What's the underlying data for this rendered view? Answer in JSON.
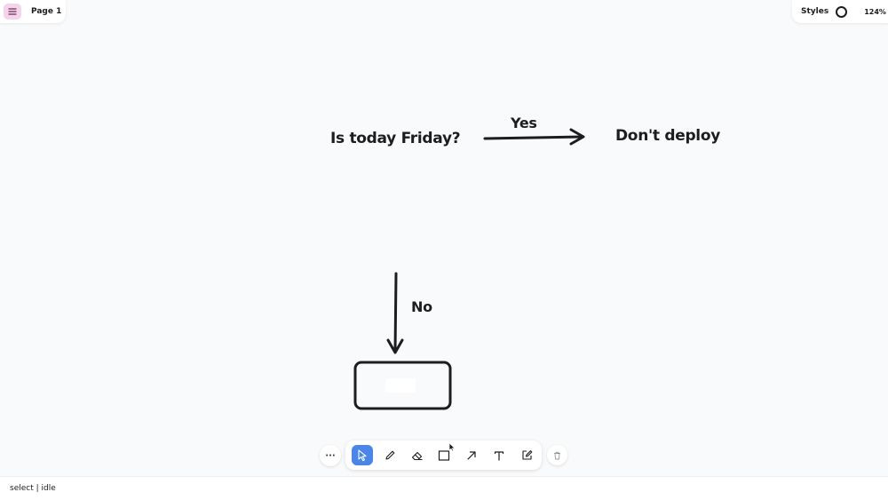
{
  "app": {
    "page_label": "Page 1",
    "styles_label": "Styles",
    "zoom": "124%"
  },
  "canvas": {
    "question_text": "Is today Friday?",
    "yes_label": "Yes",
    "result_text": "Don't deploy",
    "no_label": "No"
  },
  "toolbar": {
    "more_label": "···",
    "tools": [
      "select",
      "draw",
      "eraser",
      "rectangle",
      "arrow",
      "text",
      "note"
    ],
    "active_tool": "select",
    "accent_color": "#4a86e8"
  },
  "status": {
    "text": "select | idle"
  }
}
